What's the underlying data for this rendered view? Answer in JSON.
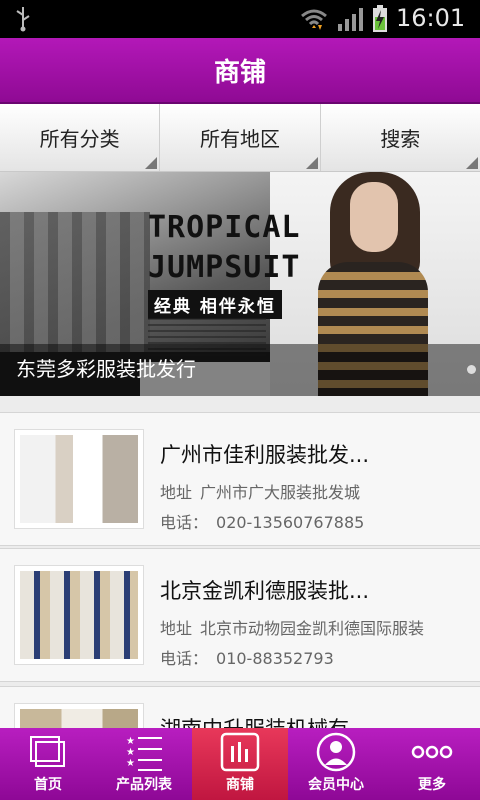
{
  "status": {
    "time": "16:01"
  },
  "header": {
    "title": "商铺"
  },
  "filters": [
    {
      "label": "所有分类"
    },
    {
      "label": "所有地区"
    },
    {
      "label": "搜索"
    }
  ],
  "banner": {
    "headline_1": "TROPICAL",
    "headline_2": "JUMPSUIT",
    "tagline": "经典 相伴永恒",
    "caption": "东莞多彩服装批发行"
  },
  "stores": [
    {
      "name": "广州市佳利服装批发...",
      "addr_label": "地址",
      "address": "广州市广大服装批发城",
      "phone_label": "电话：",
      "phone": "020-13560767885"
    },
    {
      "name": "北京金凯利德服装批...",
      "addr_label": "地址",
      "address": "北京市动物园金凯利德国际服装",
      "phone_label": "电话：",
      "phone": "010-88352793"
    },
    {
      "name": "湖南中升服装机械有...",
      "addr_label": "",
      "address": "",
      "phone_label": "",
      "phone": ""
    }
  ],
  "tabs": [
    {
      "label": "首页",
      "icon": "home-icon"
    },
    {
      "label": "产品列表",
      "icon": "list-icon"
    },
    {
      "label": "商铺",
      "icon": "shop-icon"
    },
    {
      "label": "会员中心",
      "icon": "member-icon"
    },
    {
      "label": "更多",
      "icon": "more-icon"
    }
  ],
  "colors": {
    "accent": "#a010a8",
    "active_tab": "#d8284e"
  }
}
